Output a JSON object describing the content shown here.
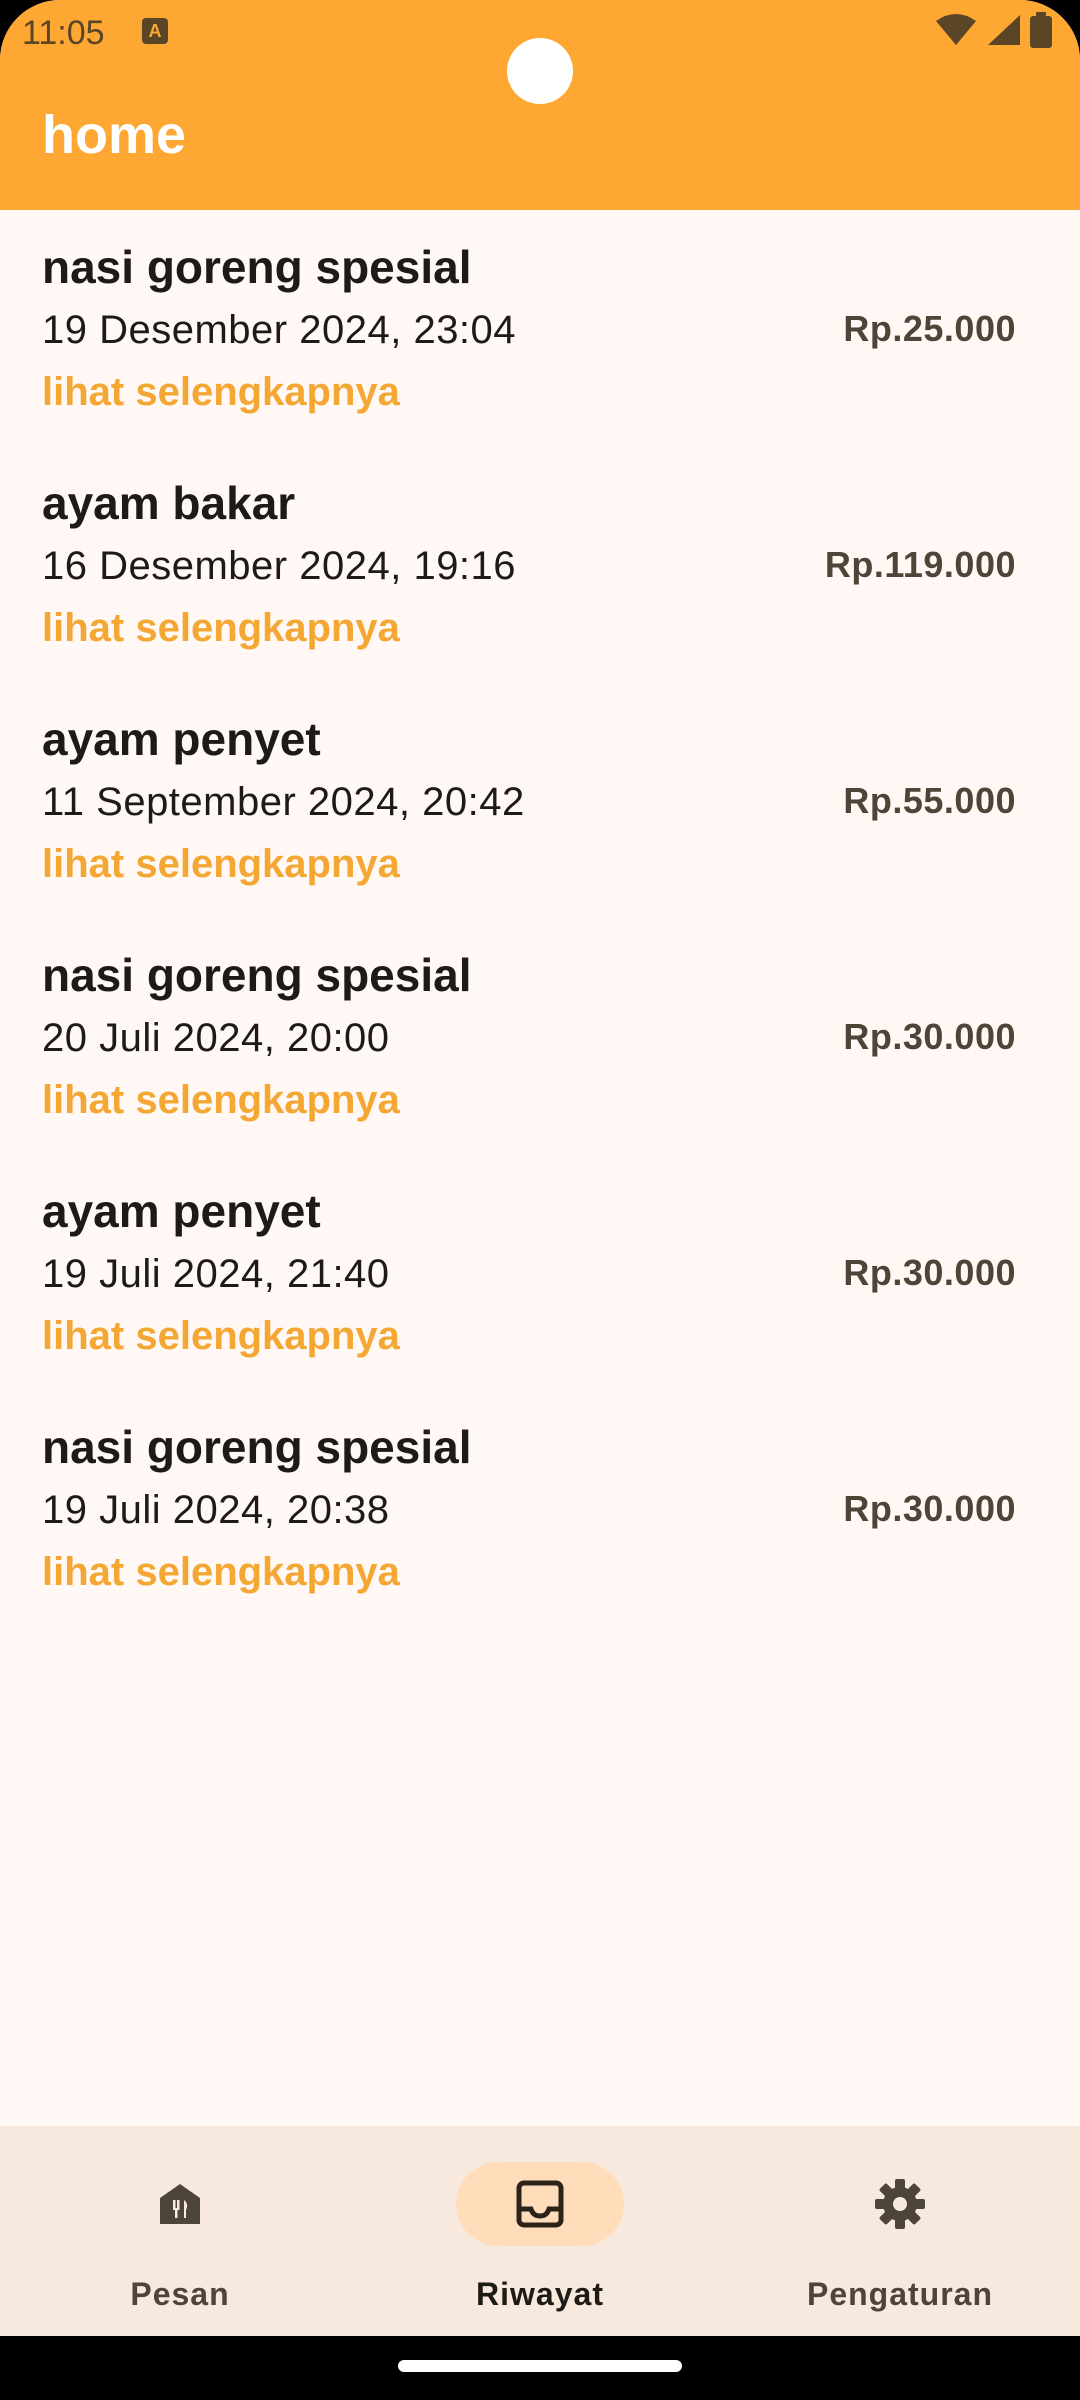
{
  "status_bar": {
    "time": "11:05",
    "icons": [
      "a-notification-icon",
      "wifi-icon",
      "cell-signal-icon",
      "battery-icon"
    ]
  },
  "header": {
    "title": "home",
    "color": "#FFA733"
  },
  "orders": [
    {
      "name": "nasi goreng spesial",
      "date": "19 Desember 2024, 23:04",
      "price": "Rp.25.000",
      "more": "lihat selengkapnya"
    },
    {
      "name": "ayam bakar",
      "date": "16 Desember 2024, 19:16",
      "price": "Rp.119.000",
      "more": "lihat selengkapnya"
    },
    {
      "name": "ayam penyet",
      "date": "11 September 2024, 20:42",
      "price": "Rp.55.000",
      "more": "lihat selengkapnya"
    },
    {
      "name": "nasi goreng spesial",
      "date": "20 Juli 2024, 20:00",
      "price": "Rp.30.000",
      "more": "lihat selengkapnya"
    },
    {
      "name": "ayam penyet",
      "date": "19 Juli 2024, 21:40",
      "price": "Rp.30.000",
      "more": "lihat selengkapnya"
    },
    {
      "name": "nasi goreng spesial",
      "date": "19 Juli 2024, 20:38",
      "price": "Rp.30.000",
      "more": "lihat selengkapnya"
    }
  ],
  "bottom_nav": {
    "items": [
      {
        "label": "Pesan",
        "icon": "restaurant-house-icon",
        "active": false
      },
      {
        "label": "Riwayat",
        "icon": "inbox-icon",
        "active": true
      },
      {
        "label": "Pengaturan",
        "icon": "gear-icon",
        "active": false
      }
    ]
  },
  "colors": {
    "accent": "#FFA733",
    "link": "#F5A733",
    "background": "#FFF8F5",
    "nav_background": "#F8E9DF",
    "nav_active_pill": "#FFDDBA"
  }
}
